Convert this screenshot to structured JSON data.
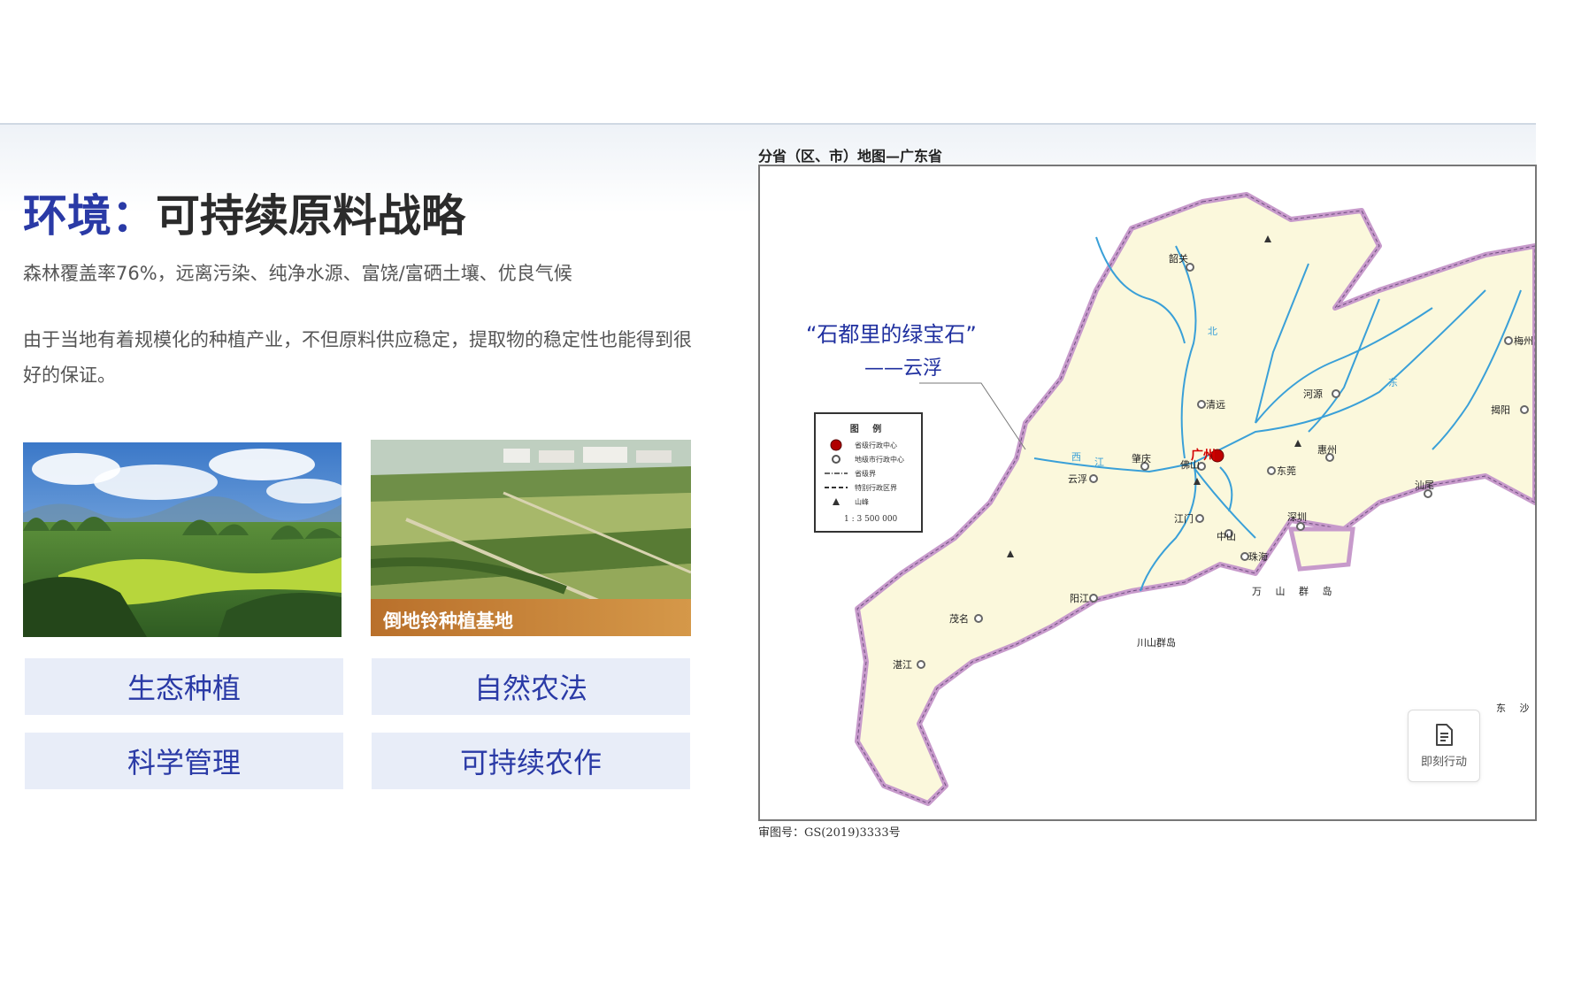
{
  "header": {
    "title_accent": "环境：",
    "title_rest": "可持续原料战略",
    "subtitle": "森林覆盖率76%，远离污染、纯净水源、富饶/富硒土壤、优良气候",
    "description": "由于当地有着规模化的种植产业，不但原料供应稳定，提取物的稳定性也能得到很好的保证。"
  },
  "photos": [
    {
      "icon": "karst-landscape-photo"
    },
    {
      "icon": "farmland-photo",
      "caption": "倒地铃种植基地"
    }
  ],
  "tags": [
    "生态种植",
    "自然农法",
    "科学管理",
    "可持续农作"
  ],
  "map": {
    "heading": "分省（区、市）地图—广东省",
    "footer": "审图号：GS(2019)3333号",
    "quote_line1": "“石都里的绿宝石”",
    "quote_line2": "——云浮",
    "legend": {
      "title": "图 例",
      "items": [
        "省级行政中心",
        "地级市行政中心",
        "省级界",
        "特别行政区界",
        "山峰"
      ],
      "scale": "1 : 3 500 000"
    },
    "cities": {
      "shaoguan": "韶关",
      "qingyuan": "清远",
      "heyuan": "河源",
      "meizhou": "梅州",
      "jieyang": "揭阳",
      "guangzhou": "广州",
      "zhaoqing": "肇庆",
      "yunfu": "云浮",
      "foshan": "佛山",
      "dongguan": "东莞",
      "huizhou": "惠州",
      "shanwei": "汕尾",
      "jiangmen": "江门",
      "zhongshan": "中山",
      "shenzhen": "深圳",
      "zhuhai": "珠海",
      "yangjiang": "阳江",
      "maoming": "茂名",
      "zhanjiang": "湛江"
    },
    "places": {
      "wanshan": "万 山 群 岛",
      "chuanshan": "川山群岛",
      "dongsha": "东 沙",
      "xijiang": "西",
      "xijiang2": "江",
      "dong": "东",
      "bei": "北",
      "jiang": "江"
    }
  },
  "action_button": {
    "icon": "document-icon",
    "label": "即刻行动"
  },
  "colors": {
    "accent": "#2a3aa6",
    "tag_bg": "#e8edf8",
    "land": "#fbf8dc",
    "border_pink": "#cc99cc",
    "water": "#3aa0d8",
    "capital": "#c00000"
  }
}
